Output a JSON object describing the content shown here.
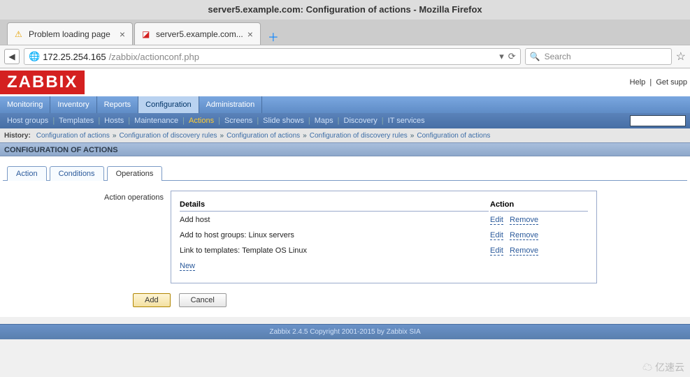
{
  "window": {
    "title": "server5.example.com: Configuration of actions - Mozilla Firefox"
  },
  "browser_tabs": [
    {
      "label": "Problem loading page"
    },
    {
      "label": "server5.example.com..."
    }
  ],
  "url": {
    "host": "172.25.254.165",
    "path": "/zabbix/actionconf.php"
  },
  "search": {
    "placeholder": "Search"
  },
  "header": {
    "logo": "ZABBIX",
    "help": "Help",
    "support": "Get supp"
  },
  "main_nav": {
    "items": [
      "Monitoring",
      "Inventory",
      "Reports",
      "Configuration",
      "Administration"
    ],
    "selected_index": 3
  },
  "sub_nav": {
    "items": [
      "Host groups",
      "Templates",
      "Hosts",
      "Maintenance",
      "Actions",
      "Screens",
      "Slide shows",
      "Maps",
      "Discovery",
      "IT services"
    ],
    "active_index": 4
  },
  "history": {
    "label": "History:",
    "items": [
      "Configuration of actions",
      "Configuration of discovery rules",
      "Configuration of actions",
      "Configuration of discovery rules",
      "Configuration of actions"
    ]
  },
  "section_title": "CONFIGURATION OF ACTIONS",
  "inner_tabs": {
    "items": [
      "Action",
      "Conditions",
      "Operations"
    ],
    "active_index": 2
  },
  "form": {
    "label": "Action operations",
    "headers": {
      "details": "Details",
      "action": "Action"
    },
    "rows": [
      {
        "details": "Add host",
        "edit": "Edit",
        "remove": "Remove"
      },
      {
        "details": "Add to host groups: Linux servers",
        "edit": "Edit",
        "remove": "Remove"
      },
      {
        "details": "Link to templates: Template OS Linux",
        "edit": "Edit",
        "remove": "Remove"
      }
    ],
    "new": "New"
  },
  "buttons": {
    "add": "Add",
    "cancel": "Cancel"
  },
  "footer": "Zabbix 2.4.5 Copyright 2001-2015 by Zabbix SIA",
  "watermark": "亿速云"
}
